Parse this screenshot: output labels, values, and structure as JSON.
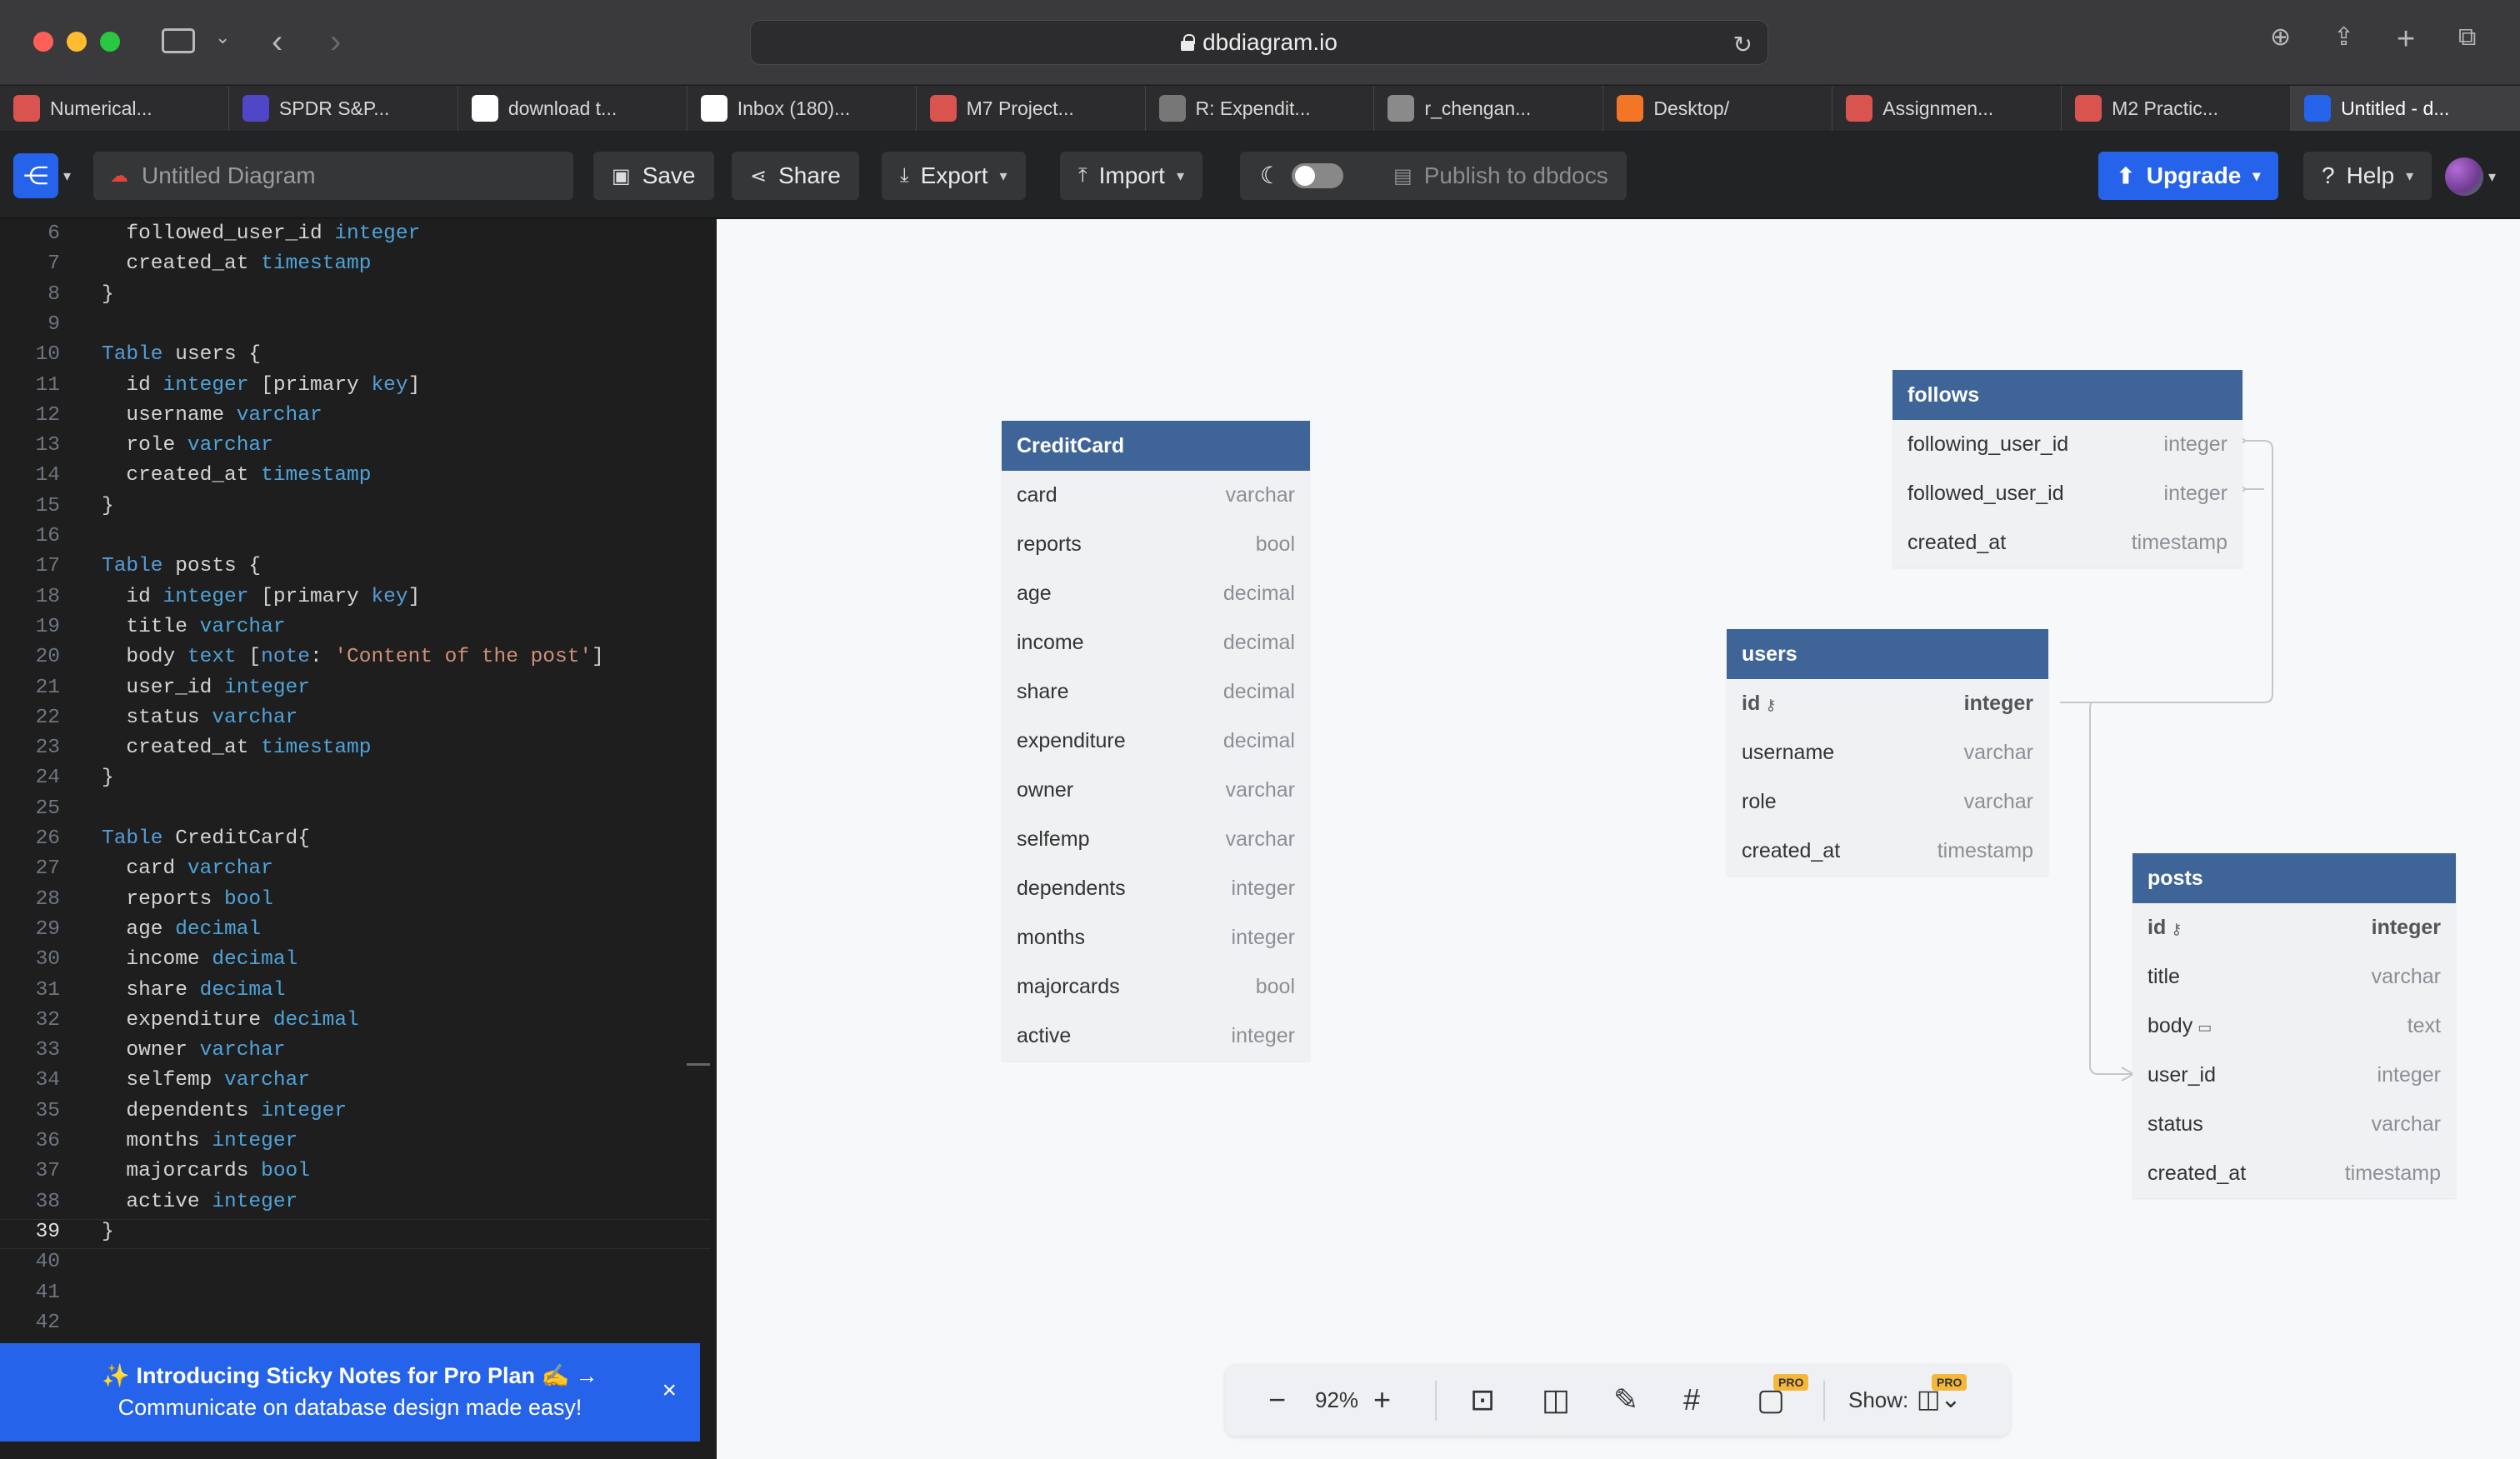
{
  "browser": {
    "url": "dbdiagram.io",
    "tabs": [
      {
        "label": "Numerical...",
        "icon": "app-icon",
        "color": "#d9534f"
      },
      {
        "label": "SPDR S&P...",
        "icon": "v-icon",
        "color": "#5046c8"
      },
      {
        "label": "download t...",
        "icon": "google-icon",
        "color": "#ffffff"
      },
      {
        "label": "Inbox (180)...",
        "icon": "gmail-icon",
        "color": "#ffffff"
      },
      {
        "label": "M7 Project...",
        "icon": "app-icon",
        "color": "#d9534f"
      },
      {
        "label": "R: Expendit...",
        "icon": "g-icon",
        "color": "#777777"
      },
      {
        "label": "r_chengan...",
        "icon": "l-icon",
        "color": "#8a8a8a"
      },
      {
        "label": "Desktop/",
        "icon": "jupyter-icon",
        "color": "#f37626"
      },
      {
        "label": "Assignmen...",
        "icon": "app-icon",
        "color": "#d9534f"
      },
      {
        "label": "M2 Practic...",
        "icon": "app-icon",
        "color": "#d9534f"
      },
      {
        "label": "Untitled - d...",
        "icon": "dbdiagram-icon",
        "color": "#2563eb"
      }
    ]
  },
  "toolbar": {
    "title_placeholder": "Untitled Diagram",
    "save": "Save",
    "share": "Share",
    "export": "Export",
    "import": "Import",
    "publish": "Publish to dbdocs",
    "upgrade": "Upgrade",
    "help": "Help"
  },
  "editor": {
    "lines": [
      {
        "n": "6",
        "t": [
          [
            "  followed_user_id ",
            ""
          ],
          [
            "integer",
            "ty"
          ]
        ]
      },
      {
        "n": "7",
        "t": [
          [
            "  created_at ",
            ""
          ],
          [
            "timestamp",
            "ty"
          ]
        ]
      },
      {
        "n": "8",
        "t": [
          [
            "}",
            ""
          ]
        ]
      },
      {
        "n": "9",
        "t": []
      },
      {
        "n": "10",
        "t": [
          [
            "Table",
            "kw"
          ],
          [
            " users {",
            ""
          ]
        ]
      },
      {
        "n": "11",
        "t": [
          [
            "  id ",
            ""
          ],
          [
            "integer",
            "ty"
          ],
          [
            " [primary ",
            ""
          ],
          [
            "key",
            "kw"
          ],
          [
            "]",
            ""
          ]
        ]
      },
      {
        "n": "12",
        "t": [
          [
            "  username ",
            ""
          ],
          [
            "varchar",
            "ty"
          ]
        ]
      },
      {
        "n": "13",
        "t": [
          [
            "  role ",
            ""
          ],
          [
            "varchar",
            "ty"
          ]
        ]
      },
      {
        "n": "14",
        "t": [
          [
            "  created_at ",
            ""
          ],
          [
            "timestamp",
            "ty"
          ]
        ]
      },
      {
        "n": "15",
        "t": [
          [
            "}",
            ""
          ]
        ]
      },
      {
        "n": "16",
        "t": []
      },
      {
        "n": "17",
        "t": [
          [
            "Table",
            "kw"
          ],
          [
            " posts {",
            ""
          ]
        ]
      },
      {
        "n": "18",
        "t": [
          [
            "  id ",
            ""
          ],
          [
            "integer",
            "ty"
          ],
          [
            " [primary ",
            ""
          ],
          [
            "key",
            "kw"
          ],
          [
            "]",
            ""
          ]
        ]
      },
      {
        "n": "19",
        "t": [
          [
            "  title ",
            ""
          ],
          [
            "varchar",
            "ty"
          ]
        ]
      },
      {
        "n": "20",
        "t": [
          [
            "  body ",
            ""
          ],
          [
            "text",
            "ty"
          ],
          [
            " [",
            ""
          ],
          [
            "note",
            "kw"
          ],
          [
            ": ",
            ""
          ],
          [
            "'Content of the post'",
            "st"
          ],
          [
            "]",
            ""
          ]
        ]
      },
      {
        "n": "21",
        "t": [
          [
            "  user_id ",
            ""
          ],
          [
            "integer",
            "ty"
          ]
        ]
      },
      {
        "n": "22",
        "t": [
          [
            "  status ",
            ""
          ],
          [
            "varchar",
            "ty"
          ]
        ]
      },
      {
        "n": "23",
        "t": [
          [
            "  created_at ",
            ""
          ],
          [
            "timestamp",
            "ty"
          ]
        ]
      },
      {
        "n": "24",
        "t": [
          [
            "}",
            ""
          ]
        ]
      },
      {
        "n": "25",
        "t": []
      },
      {
        "n": "26",
        "t": [
          [
            "Table",
            "kw"
          ],
          [
            " CreditCard{",
            ""
          ]
        ]
      },
      {
        "n": "27",
        "t": [
          [
            "  card ",
            ""
          ],
          [
            "varchar",
            "ty"
          ]
        ]
      },
      {
        "n": "28",
        "t": [
          [
            "  reports ",
            ""
          ],
          [
            "bool",
            "ty"
          ]
        ]
      },
      {
        "n": "29",
        "t": [
          [
            "  age ",
            ""
          ],
          [
            "decimal",
            "ty"
          ]
        ]
      },
      {
        "n": "30",
        "t": [
          [
            "  income ",
            ""
          ],
          [
            "decimal",
            "ty"
          ]
        ]
      },
      {
        "n": "31",
        "t": [
          [
            "  share ",
            ""
          ],
          [
            "decimal",
            "ty"
          ]
        ]
      },
      {
        "n": "32",
        "t": [
          [
            "  expenditure ",
            ""
          ],
          [
            "decimal",
            "ty"
          ]
        ]
      },
      {
        "n": "33",
        "t": [
          [
            "  owner ",
            ""
          ],
          [
            "varchar",
            "ty"
          ]
        ]
      },
      {
        "n": "34",
        "t": [
          [
            "  selfemp ",
            ""
          ],
          [
            "varchar",
            "ty"
          ]
        ]
      },
      {
        "n": "35",
        "t": [
          [
            "  dependents ",
            ""
          ],
          [
            "integer",
            "ty"
          ]
        ]
      },
      {
        "n": "36",
        "t": [
          [
            "  months ",
            ""
          ],
          [
            "integer",
            "ty"
          ]
        ]
      },
      {
        "n": "37",
        "t": [
          [
            "  majorcards ",
            ""
          ],
          [
            "bool",
            "ty"
          ]
        ]
      },
      {
        "n": "38",
        "t": [
          [
            "  active ",
            ""
          ],
          [
            "integer",
            "ty"
          ]
        ]
      },
      {
        "n": "39",
        "t": [
          [
            "}",
            ""
          ]
        ]
      },
      {
        "n": "40",
        "t": []
      },
      {
        "n": "41",
        "t": []
      },
      {
        "n": "42",
        "t": []
      }
    ],
    "current_line": "39"
  },
  "banner": {
    "line1": "✨ Introducing Sticky Notes for Pro Plan ✍️ →",
    "line2": "Communicate on database design made easy!",
    "close": "×"
  },
  "tables": {
    "creditcard": {
      "name": "CreditCard",
      "fields": [
        [
          "card",
          "varchar"
        ],
        [
          "reports",
          "bool"
        ],
        [
          "age",
          "decimal"
        ],
        [
          "income",
          "decimal"
        ],
        [
          "share",
          "decimal"
        ],
        [
          "expenditure",
          "decimal"
        ],
        [
          "owner",
          "varchar"
        ],
        [
          "selfemp",
          "varchar"
        ],
        [
          "dependents",
          "integer"
        ],
        [
          "months",
          "integer"
        ],
        [
          "majorcards",
          "bool"
        ],
        [
          "active",
          "integer"
        ]
      ]
    },
    "follows": {
      "name": "follows",
      "fields": [
        [
          "following_user_id",
          "integer"
        ],
        [
          "followed_user_id",
          "integer"
        ],
        [
          "created_at",
          "timestamp"
        ]
      ]
    },
    "users": {
      "name": "users",
      "fields": [
        [
          "id",
          "integer"
        ],
        [
          "username",
          "varchar"
        ],
        [
          "role",
          "varchar"
        ],
        [
          "created_at",
          "timestamp"
        ]
      ]
    },
    "posts": {
      "name": "posts",
      "fields": [
        [
          "id",
          "integer"
        ],
        [
          "title",
          "varchar"
        ],
        [
          "body",
          "text"
        ],
        [
          "user_id",
          "integer"
        ],
        [
          "status",
          "varchar"
        ],
        [
          "created_at",
          "timestamp"
        ]
      ]
    }
  },
  "zoom": {
    "level": "92%",
    "show_label": "Show:",
    "pro_badge": "PRO"
  }
}
